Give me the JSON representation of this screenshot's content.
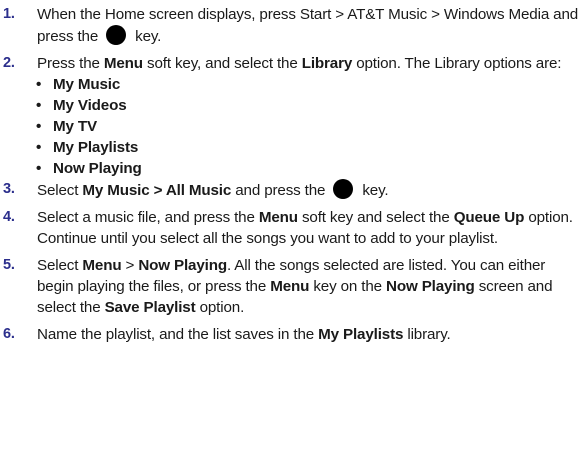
{
  "steps": [
    {
      "num": "1.",
      "a": "When the Home screen displays, press Start > AT&T Music > Windows Media and press the",
      "b": "key."
    },
    {
      "num": "2.",
      "a": "Press the ",
      "menu": "Menu",
      "b": " soft key, and select the ",
      "library": "Library",
      "c": " option. The Library options are:"
    },
    {
      "num": "3.",
      "a": "Select ",
      "path": "My Music > All Music",
      "b": " and press the",
      "c": "key."
    },
    {
      "num": "4.",
      "a": "Select a music file, and press the ",
      "menu": "Menu",
      "b": " soft key and select the ",
      "queue": "Queue Up",
      "c": " option. Continue until you select all the songs you want to add to your playlist."
    },
    {
      "num": "5.",
      "a": "Select ",
      "menu": "Menu",
      "b": " > ",
      "now": "Now Playing",
      "c": ". All the songs selected are listed. You can either begin playing the files, or press the ",
      "menu2": "Menu",
      "d": " key on the ",
      "now2": "Now Playing",
      "e": " screen and select the ",
      "save": "Save Playlist",
      "f": " option."
    },
    {
      "num": "6.",
      "a": "Name the playlist, and the list saves in the ",
      "lib": "My Playlists",
      "b": " library."
    }
  ],
  "library_options": [
    "My Music",
    "My Videos",
    "My TV",
    "My Playlists",
    "Now Playing"
  ],
  "bullet": "•",
  "colors": {
    "step_number": "#2b2e8c",
    "key_icon": "#000000"
  }
}
